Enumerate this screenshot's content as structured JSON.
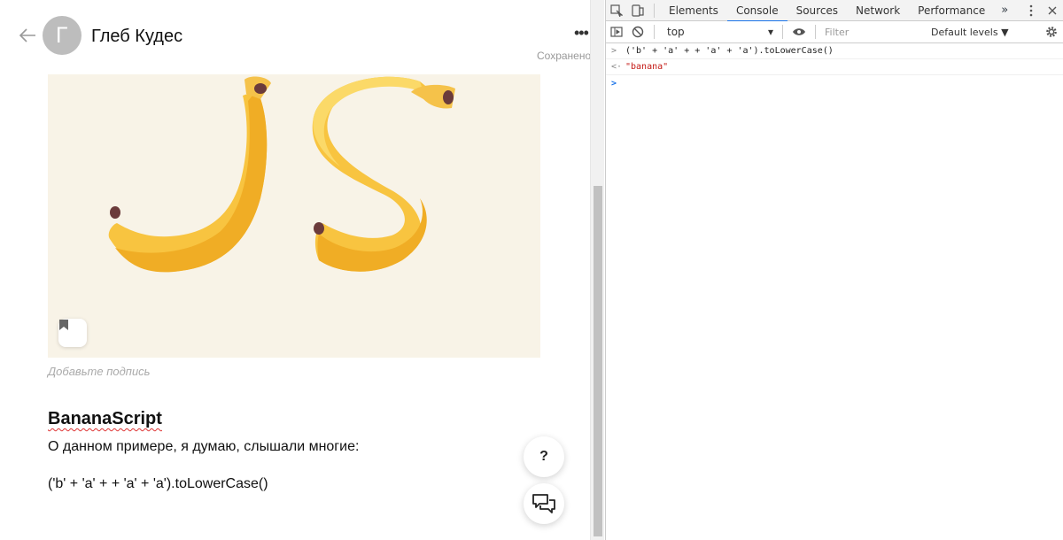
{
  "article": {
    "author_initial": "Г",
    "author_name": "Глеб Кудес",
    "saved_status": "Сохранено",
    "more_label": "•••",
    "cover_text": "JS",
    "caption_placeholder": "Добавьте подпись",
    "heading": "BananaScript",
    "paragraph": "О данном примере, я думаю, слышали многие:",
    "code_line": "('b' + 'a' + + 'a' + 'a').toLowerCase()",
    "help_label": "?"
  },
  "devtools": {
    "tabs": [
      "Elements",
      "Console",
      "Sources",
      "Network",
      "Performance"
    ],
    "active_tab": "Console",
    "more_tabs": "»",
    "context": "top",
    "filter_placeholder": "Filter",
    "levels": "Default levels ▼",
    "console": {
      "input_prefix": ">",
      "input_code": "('b' + 'a' + + 'a' + 'a').toLowerCase()",
      "result_prefix": "<·",
      "result_value": "\"banana\"",
      "prompt_prefix": ">"
    }
  },
  "colors": {
    "banana": "#f8c440",
    "cover_bg": "#f8f3e7",
    "accent": "#1a73e8"
  }
}
